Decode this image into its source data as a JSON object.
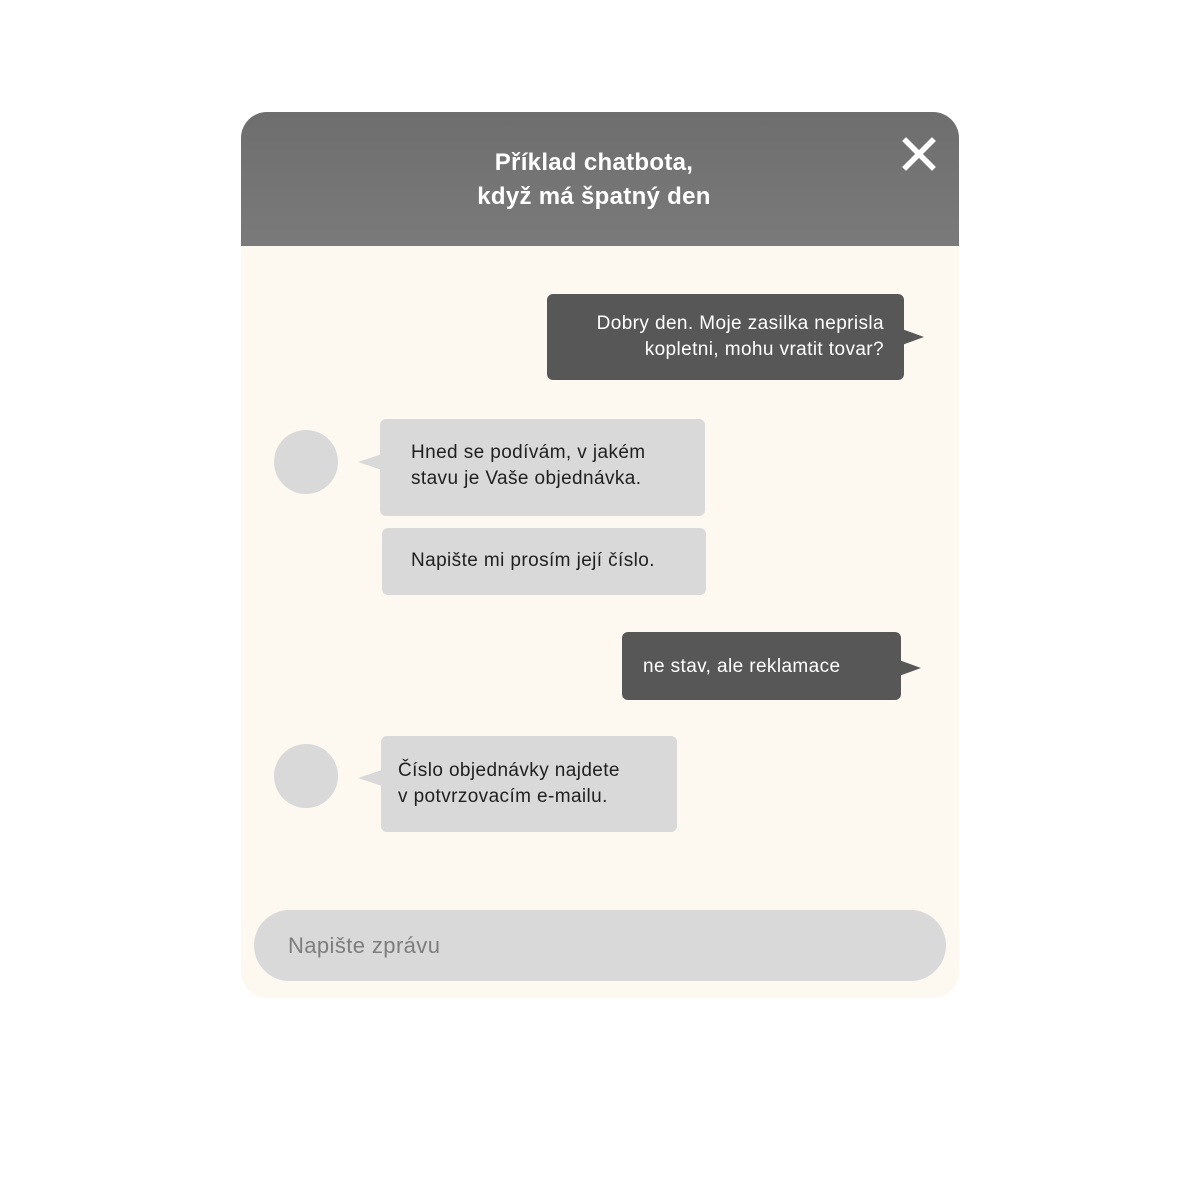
{
  "chat": {
    "title_line1": "Příklad chatbota,",
    "title_line2": "když má špatný den",
    "close_icon": "close-icon",
    "messages": [
      {
        "sender": "user",
        "lines": [
          "Dobry den. Moje zasilka neprisla",
          "kopletni, mohu vratit tovar?"
        ]
      },
      {
        "sender": "bot",
        "lines": [
          "Hned se podívám, v jakém",
          "stavu je Vaše objednávka."
        ]
      },
      {
        "sender": "bot",
        "lines": [
          "Napište mi prosím její číslo."
        ]
      },
      {
        "sender": "user",
        "lines": [
          "ne stav, ale reklamace"
        ]
      },
      {
        "sender": "bot",
        "lines": [
          "Číslo objednávky najdete",
          "v potvrzovacím e-mailu."
        ]
      }
    ],
    "input": {
      "placeholder": "Napište zprávu",
      "value": ""
    }
  },
  "colors": {
    "header_bg": "#737373",
    "body_bg": "#fdf9f1",
    "user_bubble": "#575757",
    "bot_bubble": "#d9d9d9",
    "input_bg": "#d9d9d9"
  }
}
